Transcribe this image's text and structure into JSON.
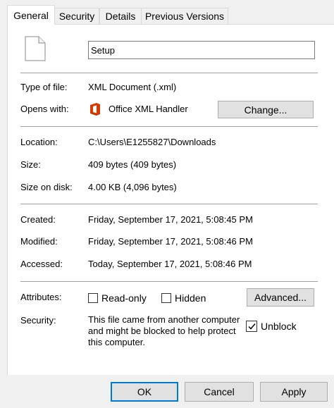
{
  "tabs": [
    {
      "label": "General",
      "active": true
    },
    {
      "label": "Security"
    },
    {
      "label": "Details"
    },
    {
      "label": "Previous Versions"
    }
  ],
  "file": {
    "icon": "document-icon",
    "name": "Setup"
  },
  "fields": {
    "type_label": "Type of file:",
    "type_value": "XML Document (.xml)",
    "opens_label": "Opens with:",
    "opens_value": "Office XML Handler",
    "opens_icon": "office-icon",
    "change_button": "Change...",
    "location_label": "Location:",
    "location_value": "C:\\Users\\E1255827\\Downloads",
    "size_label": "Size:",
    "size_value": "409 bytes (409 bytes)",
    "size_disk_label": "Size on disk:",
    "size_disk_value": "4.00 KB (4,096 bytes)",
    "created_label": "Created:",
    "created_value": "Friday, September 17, 2021, 5:08:45 PM",
    "modified_label": "Modified:",
    "modified_value": "Friday, September 17, 2021, 5:08:46 PM",
    "accessed_label": "Accessed:",
    "accessed_value": "Today, September 17, 2021, 5:08:46 PM"
  },
  "attributes": {
    "label": "Attributes:",
    "readonly_label": "Read-only",
    "readonly_checked": false,
    "hidden_label": "Hidden",
    "hidden_checked": false,
    "advanced_button": "Advanced..."
  },
  "security": {
    "label": "Security:",
    "text": "This file came from another computer and might be blocked to help protect this computer.",
    "unblock_label": "Unblock",
    "unblock_checked": true
  },
  "buttons": {
    "ok": "OK",
    "cancel": "Cancel",
    "apply": "Apply"
  },
  "colors": {
    "office_orange": "#d83b01",
    "focus_blue": "#0078d7"
  }
}
